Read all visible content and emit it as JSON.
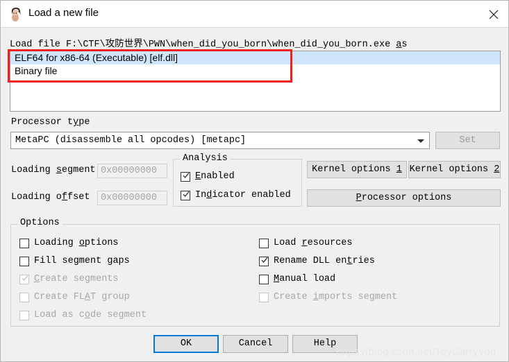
{
  "window": {
    "title": "Load a new file",
    "icon": "ida-woman-icon",
    "close_label": "✕"
  },
  "file_prompt": {
    "prefix": "Load file ",
    "path": "F:\\CTF\\攻防世界\\PWN\\when_did_you_born\\when_did_you_born.exe",
    "suffix_before_mnemonic": " ",
    "suffix_mnemonic": "a",
    "suffix_after_mnemonic": "s"
  },
  "format_list": {
    "items": [
      {
        "label": "ELF64 for x86-64 (Executable) [elf.dll]",
        "selected": true
      },
      {
        "label": "Binary file",
        "selected": false
      }
    ],
    "selection_color": "#cfe5f9",
    "annotation_color": "#f02020"
  },
  "processor": {
    "label_before": "Processor t",
    "label_mnemonic": "y",
    "label_after": "pe",
    "selected_value": "MetaPC (disassemble all opcodes) [metapc]",
    "set_button": "Set",
    "set_button_enabled": false
  },
  "loading": {
    "segment": {
      "label_before": "Loading ",
      "label_mnemonic": "s",
      "label_after": "egment",
      "value": "0x00000000",
      "enabled": false
    },
    "offset": {
      "label_before": "Loading o",
      "label_mnemonic": "f",
      "label_after": "fset",
      "value": "0x00000000",
      "enabled": false
    }
  },
  "analysis": {
    "group_title": "Analysis",
    "items": [
      {
        "before": "",
        "mnemonic": "E",
        "after": "nabled",
        "checked": true,
        "enabled": true
      },
      {
        "before": "In",
        "mnemonic": "d",
        "after": "icator enabled",
        "checked": true,
        "enabled": true
      }
    ]
  },
  "side_buttons": [
    {
      "before": "Kernel options ",
      "mnemonic": "1",
      "after": ""
    },
    {
      "before": "Kernel options ",
      "mnemonic": "2",
      "after": ""
    },
    {
      "before": "",
      "mnemonic": "P",
      "after": "rocessor options"
    }
  ],
  "options": {
    "group_title": "Options",
    "left": [
      {
        "before": "Loading ",
        "mnemonic": "o",
        "after": "ptions",
        "checked": false,
        "enabled": true
      },
      {
        "before": "Fill segment ",
        "mnemonic": "g",
        "after": "aps",
        "checked": false,
        "enabled": true
      },
      {
        "before": "",
        "mnemonic": "C",
        "after": "reate segments",
        "checked": true,
        "enabled": false
      },
      {
        "before": "Create FL",
        "mnemonic": "A",
        "after": "T group",
        "checked": false,
        "enabled": false
      },
      {
        "before": "Load as c",
        "mnemonic": "o",
        "after": "de segment",
        "checked": false,
        "enabled": false
      }
    ],
    "right": [
      {
        "before": "Load ",
        "mnemonic": "r",
        "after": "esources",
        "checked": false,
        "enabled": true
      },
      {
        "before": "Rename DLL en",
        "mnemonic": "t",
        "after": "ries",
        "checked": true,
        "enabled": true
      },
      {
        "before": "",
        "mnemonic": "M",
        "after": "anual load",
        "checked": false,
        "enabled": true
      },
      {
        "before": "Create ",
        "mnemonic": "i",
        "after": "mports segment",
        "checked": false,
        "enabled": false
      }
    ]
  },
  "footer": {
    "ok": "OK",
    "cancel": "Cancel",
    "help": "Help",
    "default_button": "ok"
  },
  "watermark": "https://blog.csdn.net/ToyCarryYou"
}
